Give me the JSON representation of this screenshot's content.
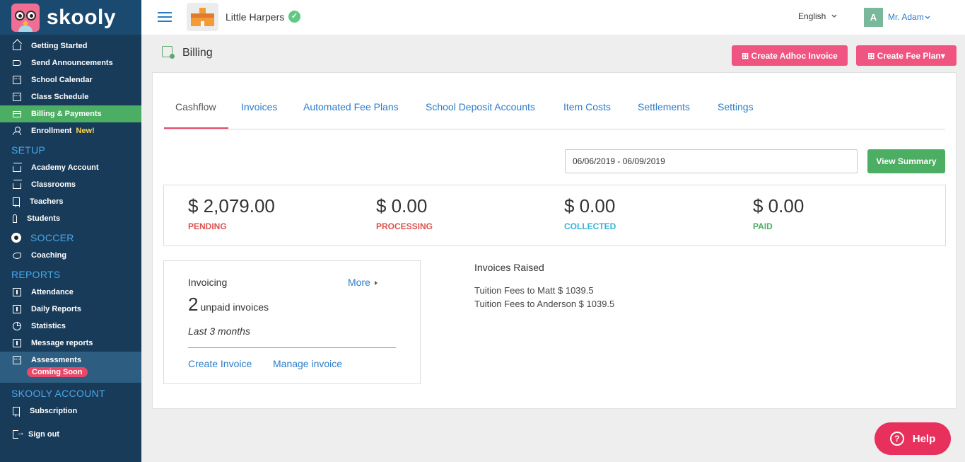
{
  "brand": {
    "name": "skooly"
  },
  "sidebar": {
    "items": [
      {
        "label": "Getting Started"
      },
      {
        "label": "Send Announcements"
      },
      {
        "label": "School Calendar"
      },
      {
        "label": "Class Schedule"
      },
      {
        "label": "Billing & Payments"
      },
      {
        "label": "Enrollment",
        "badge": "New!"
      }
    ],
    "setup_heading": "SETUP",
    "setup_items": [
      {
        "label": "Academy Account"
      },
      {
        "label": "Classrooms"
      },
      {
        "label": "Teachers"
      },
      {
        "label": "Students"
      }
    ],
    "soccer_heading": "SOCCER",
    "soccer_items": [
      {
        "label": "Coaching"
      }
    ],
    "reports_heading": "REPORTS",
    "reports_items": [
      {
        "label": "Attendance"
      },
      {
        "label": "Daily Reports"
      },
      {
        "label": "Statistics"
      },
      {
        "label": "Message reports"
      },
      {
        "label": "Assessments",
        "badge": "Coming Soon"
      }
    ],
    "account_heading": "SKOOLY ACCOUNT",
    "account_items": [
      {
        "label": "Subscription"
      },
      {
        "label": "Sign out"
      }
    ]
  },
  "header": {
    "school_name": "Little Harpers",
    "verified_glyph": "✓",
    "language": "English",
    "avatar_letter": "A",
    "user_name": "Mr. Adam"
  },
  "page": {
    "title": "Billing",
    "create_adhoc_label": "⊞ Create Adhoc Invoice",
    "create_fee_plan_label": "⊞ Create Fee Plan▾"
  },
  "tabs": [
    {
      "label": "Cashflow"
    },
    {
      "label": "Invoices"
    },
    {
      "label": "Automated Fee Plans"
    },
    {
      "label": "School Deposit Accounts"
    },
    {
      "label": "Item Costs"
    },
    {
      "label": "Settlements"
    },
    {
      "label": "Settings"
    }
  ],
  "filter": {
    "date_range": "06/06/2019 - 06/09/2019",
    "view_summary_label": "View Summary"
  },
  "stats": [
    {
      "amount": "$ 2,079.00",
      "label": "PENDING",
      "color": "#d9534f"
    },
    {
      "amount": "$ 0.00",
      "label": "PROCESSING",
      "color": "#d9534f"
    },
    {
      "amount": "$ 0.00",
      "label": "COLLECTED",
      "color": "#36b2d8"
    },
    {
      "amount": "$ 0.00",
      "label": "PAID",
      "color": "#4cae62"
    }
  ],
  "invoicing": {
    "title": "Invoicing",
    "more_label": "More",
    "unpaid_count": "2",
    "unpaid_text": "unpaid invoices",
    "period": "Last 3 months",
    "create_label": "Create Invoice",
    "manage_label": "Manage invoice"
  },
  "invoices_raised": {
    "title": "Invoices Raised",
    "items": [
      "Tuition Fees to Matt $ 1039.5",
      "Tuition Fees to Anderson $ 1039.5"
    ]
  },
  "help": {
    "label": "Help",
    "glyph": "?"
  },
  "colors": {
    "sidebar_bg": "#183b5a",
    "brand_bar": "#1b4a70",
    "active_green": "#4cae62",
    "accent_pink": "#f05582",
    "link_blue": "#2b7bc9"
  }
}
